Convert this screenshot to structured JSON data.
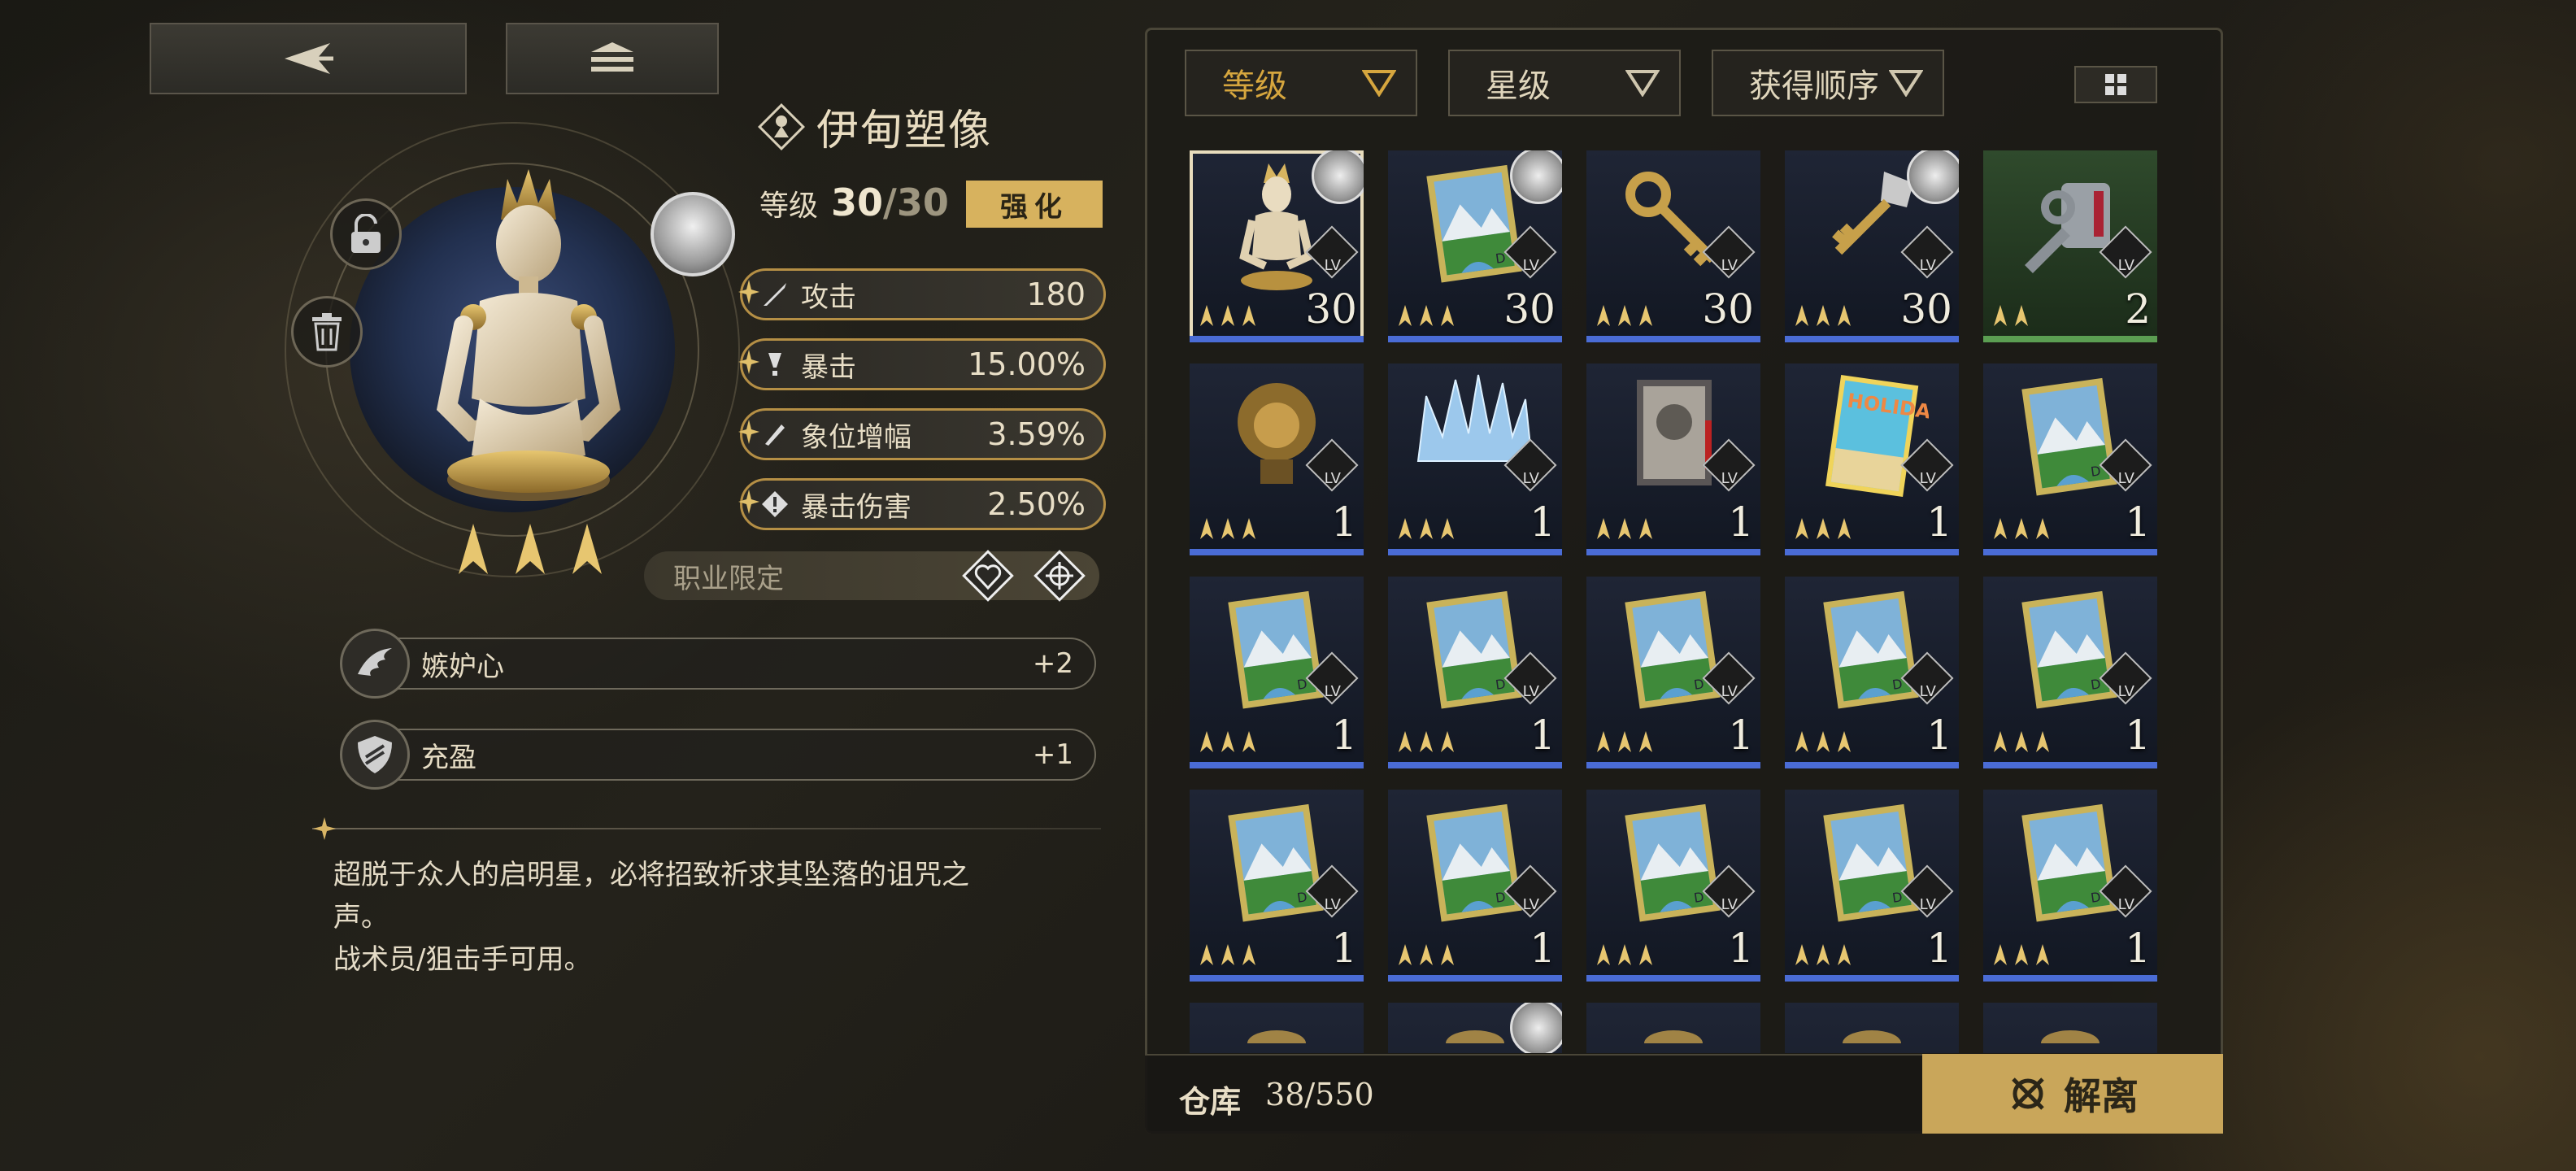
{
  "nav": {
    "back_icon": "back-arrow-icon",
    "home_icon": "stack-icon"
  },
  "item": {
    "name": "伊甸塑像",
    "level_label": "等级",
    "level_current": "30",
    "level_sep": "/",
    "level_max": "30",
    "enhance_label": "强化",
    "stars": 3
  },
  "stats": [
    {
      "name": "攻击",
      "value": "180",
      "icon": "sword-icon"
    },
    {
      "name": "暴击",
      "value": "15.00%",
      "icon": "crit-icon"
    },
    {
      "name": "象位增幅",
      "value": "3.59%",
      "icon": "blade-icon"
    },
    {
      "name": "暴击伤害",
      "value": "2.50%",
      "icon": "crit-damage-icon"
    }
  ],
  "class_limit": {
    "label": "职业限定",
    "icons": [
      "heart-class-icon",
      "crosshair-class-icon"
    ]
  },
  "skills": [
    {
      "name": "嫉妒心",
      "value": "+2",
      "icon": "wing-icon"
    },
    {
      "name": "充盈",
      "value": "+1",
      "icon": "shield-icon"
    }
  ],
  "description": {
    "line1": "超脱于众人的启明星，必将招致祈求其坠落的诅咒之",
    "line2": "声。",
    "line3": "战术员/狙击手可用。"
  },
  "filters": [
    {
      "label": "等级"
    },
    {
      "label": "星级"
    },
    {
      "label": "获得顺序"
    }
  ],
  "view_toggle_icon": "grid-view-icon",
  "inventory": [
    {
      "art": "statue",
      "stars": 3,
      "level": "30",
      "lv": "LV",
      "equipped": true,
      "rarity": "blue",
      "selected": true
    },
    {
      "art": "book-landscape",
      "stars": 3,
      "level": "30",
      "lv": "LV",
      "equipped": true,
      "rarity": "blue"
    },
    {
      "art": "key-gold",
      "stars": 3,
      "level": "30",
      "lv": "LV",
      "equipped": false,
      "rarity": "blue"
    },
    {
      "art": "key-ornate",
      "stars": 3,
      "level": "30",
      "lv": "LV",
      "equipped": true,
      "rarity": "blue"
    },
    {
      "art": "key-gray",
      "stars": 2,
      "level": "2",
      "lv": "LV",
      "equipped": false,
      "rarity": "green"
    },
    {
      "art": "lion-head",
      "stars": 3,
      "level": "1",
      "lv": "LV",
      "equipped": false,
      "rarity": "blue"
    },
    {
      "art": "ice-crown",
      "stars": 3,
      "level": "1",
      "lv": "LV",
      "equipped": false,
      "rarity": "blue"
    },
    {
      "art": "photo-book",
      "stars": 3,
      "level": "1",
      "lv": "LV",
      "equipped": false,
      "rarity": "blue"
    },
    {
      "art": "holiday-book",
      "stars": 3,
      "level": "1",
      "lv": "LV",
      "equipped": false,
      "rarity": "blue"
    },
    {
      "art": "book-landscape",
      "stars": 3,
      "level": "1",
      "lv": "LV",
      "equipped": false,
      "rarity": "blue"
    },
    {
      "art": "book-landscape",
      "stars": 3,
      "level": "1",
      "lv": "LV",
      "equipped": false,
      "rarity": "blue"
    },
    {
      "art": "book-landscape",
      "stars": 3,
      "level": "1",
      "lv": "LV",
      "equipped": false,
      "rarity": "blue"
    },
    {
      "art": "book-landscape",
      "stars": 3,
      "level": "1",
      "lv": "LV",
      "equipped": false,
      "rarity": "blue"
    },
    {
      "art": "book-landscape",
      "stars": 3,
      "level": "1",
      "lv": "LV",
      "equipped": false,
      "rarity": "blue"
    },
    {
      "art": "book-landscape",
      "stars": 3,
      "level": "1",
      "lv": "LV",
      "equipped": false,
      "rarity": "blue"
    },
    {
      "art": "book-landscape",
      "stars": 3,
      "level": "1",
      "lv": "LV",
      "equipped": false,
      "rarity": "blue"
    },
    {
      "art": "book-landscape",
      "stars": 3,
      "level": "1",
      "lv": "LV",
      "equipped": false,
      "rarity": "blue"
    },
    {
      "art": "book-landscape",
      "stars": 3,
      "level": "1",
      "lv": "LV",
      "equipped": false,
      "rarity": "blue"
    },
    {
      "art": "book-landscape",
      "stars": 3,
      "level": "1",
      "lv": "LV",
      "equipped": false,
      "rarity": "blue"
    },
    {
      "art": "book-landscape",
      "stars": 3,
      "level": "1",
      "lv": "LV",
      "equipped": false,
      "rarity": "blue"
    },
    {
      "art": "partial",
      "stars": 0,
      "level": "",
      "lv": "",
      "equipped": false,
      "rarity": "blue"
    },
    {
      "art": "partial",
      "stars": 0,
      "level": "",
      "lv": "",
      "equipped": true,
      "rarity": "blue"
    },
    {
      "art": "partial",
      "stars": 0,
      "level": "",
      "lv": "",
      "equipped": false,
      "rarity": "blue"
    },
    {
      "art": "partial",
      "stars": 0,
      "level": "",
      "lv": "",
      "equipped": false,
      "rarity": "blue"
    },
    {
      "art": "partial",
      "stars": 0,
      "level": "",
      "lv": "",
      "equipped": false,
      "rarity": "blue"
    }
  ],
  "warehouse": {
    "label": "仓库",
    "count": "38/550"
  },
  "dismantle": {
    "label": "解离",
    "icon": "dismantle-icon"
  },
  "colors": {
    "gold": "#c9a65a",
    "accent": "#d6a63e",
    "rarity_blue": "#4a6cd6",
    "rarity_green": "#5b9e52"
  }
}
